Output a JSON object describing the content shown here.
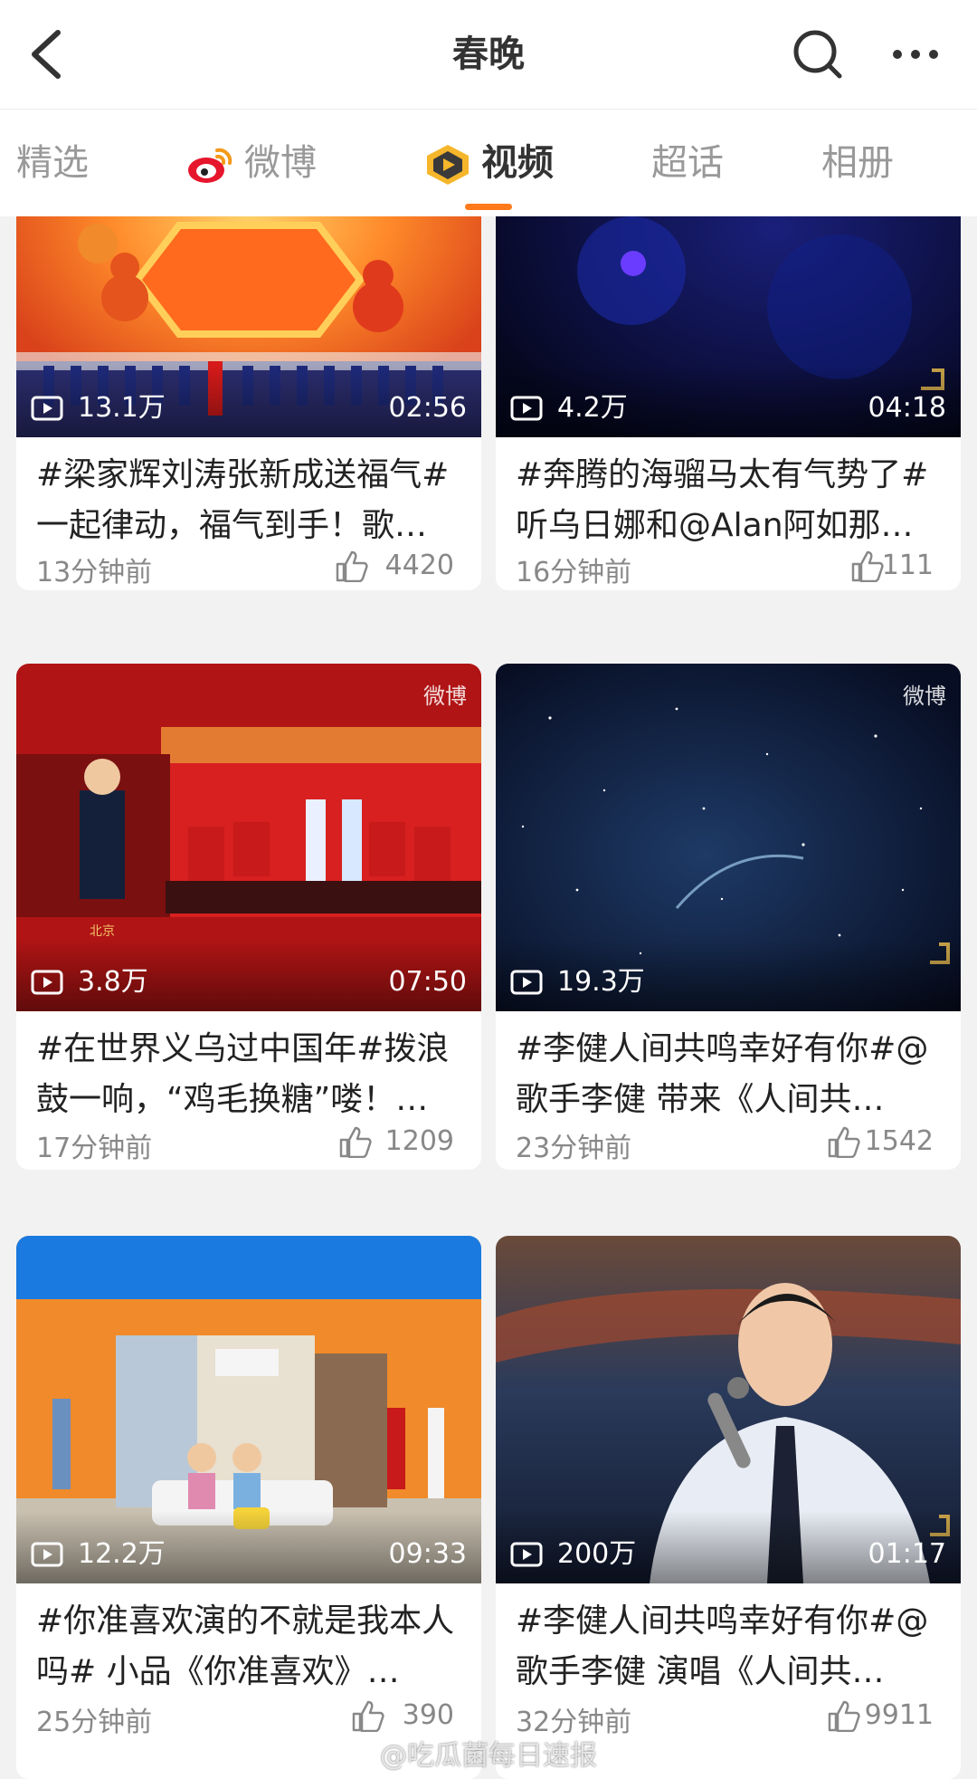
{
  "header": {
    "title": "春晚",
    "back_icon": "back-arrow-icon",
    "search_icon": "search-icon",
    "more_icon": "more-icon"
  },
  "tabs": [
    {
      "label": "精选",
      "active": false
    },
    {
      "label": "微博",
      "active": false,
      "icon": "weibo-logo-icon"
    },
    {
      "label": "视频",
      "active": true,
      "icon": "video-play-icon"
    },
    {
      "label": "超话",
      "active": false
    },
    {
      "label": "相册",
      "active": false
    }
  ],
  "accent_color": "#ff7a1a",
  "cards": [
    {
      "views": "13.1万",
      "duration": "02:56",
      "title": "#梁家辉刘涛张新成送福气#一起律动，福气到手！歌…",
      "time": "13分钟前",
      "likes": "4420"
    },
    {
      "views": "4.2万",
      "duration": "04:18",
      "title": "#奔腾的海骝马太有气势了#听乌日娜和@Alan阿如那…",
      "time": "16分钟前",
      "likes": "111"
    },
    {
      "views": "3.8万",
      "duration": "07:50",
      "title": "#在世界义乌过中国年#拨浪鼓一响，“鸡毛换糖”喽！…",
      "time": "17分钟前",
      "likes": "1209",
      "watermark": "微博"
    },
    {
      "views": "19.3万",
      "duration": "",
      "title": "#李健人间共鸣幸好有你#@歌手李健 带来《人间共…",
      "time": "23分钟前",
      "likes": "1542",
      "watermark": "微博"
    },
    {
      "views": "12.2万",
      "duration": "09:33",
      "title": "#你准喜欢演的不就是我本人吗# 小品《你准喜欢》…",
      "time": "25分钟前",
      "likes": "390"
    },
    {
      "views": "200万",
      "duration": "01:17",
      "title": "#李健人间共鸣幸好有你#@歌手李健 演唱《人间共…",
      "time": "32分钟前",
      "likes": "9911"
    }
  ],
  "bottom_watermark": "@吃瓜菌每日速报"
}
